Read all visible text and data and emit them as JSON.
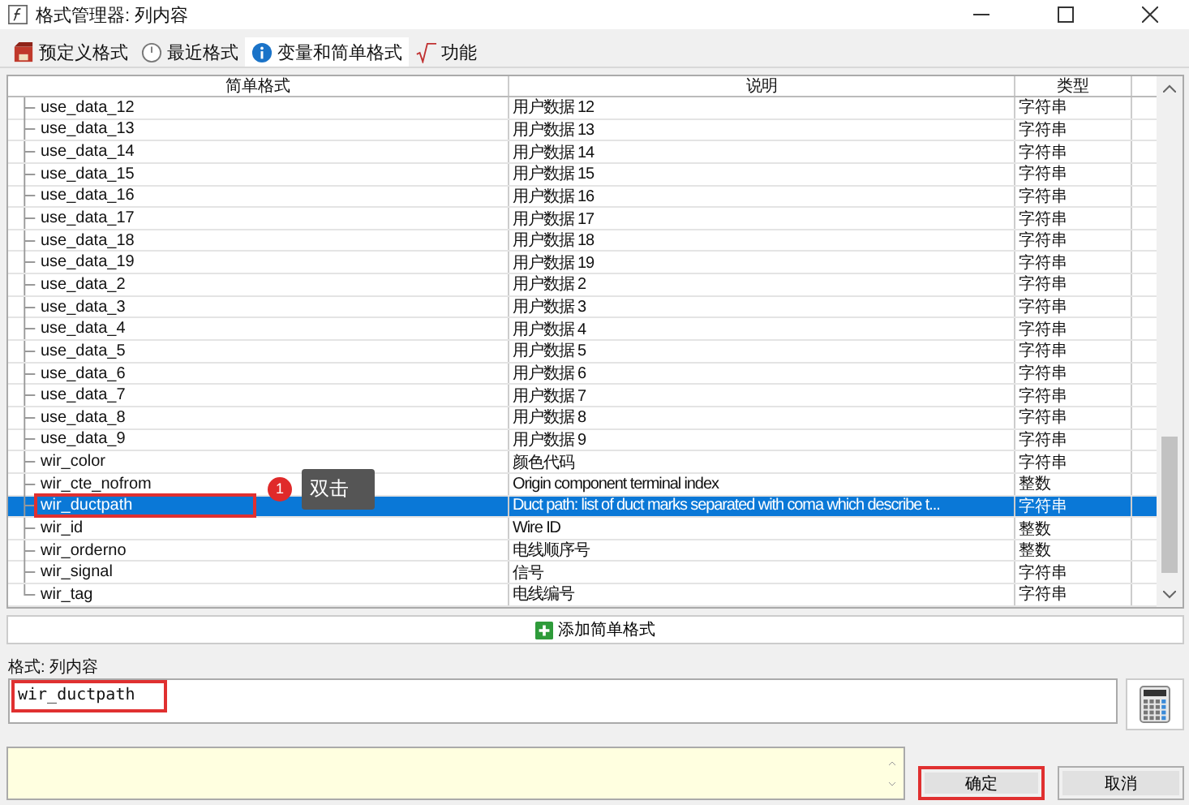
{
  "window": {
    "title": "格式管理器: 列内容"
  },
  "tabs": [
    {
      "label": "预定义格式",
      "selected": false
    },
    {
      "label": "最近格式",
      "selected": false
    },
    {
      "label": "变量和简单格式",
      "selected": true
    },
    {
      "label": "功能",
      "selected": false
    }
  ],
  "table": {
    "columns": [
      "简单格式",
      "说明",
      "类型"
    ],
    "rows": [
      {
        "name": "use_data_12",
        "desc": "用户数据 12",
        "type": "字符串",
        "selected": false
      },
      {
        "name": "use_data_13",
        "desc": "用户数据 13",
        "type": "字符串",
        "selected": false
      },
      {
        "name": "use_data_14",
        "desc": "用户数据 14",
        "type": "字符串",
        "selected": false
      },
      {
        "name": "use_data_15",
        "desc": "用户数据 15",
        "type": "字符串",
        "selected": false
      },
      {
        "name": "use_data_16",
        "desc": "用户数据 16",
        "type": "字符串",
        "selected": false
      },
      {
        "name": "use_data_17",
        "desc": "用户数据 17",
        "type": "字符串",
        "selected": false
      },
      {
        "name": "use_data_18",
        "desc": "用户数据 18",
        "type": "字符串",
        "selected": false
      },
      {
        "name": "use_data_19",
        "desc": "用户数据 19",
        "type": "字符串",
        "selected": false
      },
      {
        "name": "use_data_2",
        "desc": "用户数据 2",
        "type": "字符串",
        "selected": false
      },
      {
        "name": "use_data_3",
        "desc": "用户数据 3",
        "type": "字符串",
        "selected": false
      },
      {
        "name": "use_data_4",
        "desc": "用户数据 4",
        "type": "字符串",
        "selected": false
      },
      {
        "name": "use_data_5",
        "desc": "用户数据 5",
        "type": "字符串",
        "selected": false
      },
      {
        "name": "use_data_6",
        "desc": "用户数据 6",
        "type": "字符串",
        "selected": false
      },
      {
        "name": "use_data_7",
        "desc": "用户数据 7",
        "type": "字符串",
        "selected": false
      },
      {
        "name": "use_data_8",
        "desc": "用户数据 8",
        "type": "字符串",
        "selected": false
      },
      {
        "name": "use_data_9",
        "desc": "用户数据 9",
        "type": "字符串",
        "selected": false
      },
      {
        "name": "wir_color",
        "desc": "颜色代码",
        "type": "字符串",
        "selected": false
      },
      {
        "name": "wir_cte_nofrom",
        "desc": "Origin component terminal index",
        "type": "整数",
        "selected": false
      },
      {
        "name": "wir_ductpath",
        "desc": "Duct path: list of duct marks separated with coma which describe t...",
        "type": "字符串",
        "selected": true,
        "highlighted": true
      },
      {
        "name": "wir_id",
        "desc": "Wire ID",
        "type": "整数",
        "selected": false
      },
      {
        "name": "wir_orderno",
        "desc": "电线顺序号",
        "type": "整数",
        "selected": false
      },
      {
        "name": "wir_signal",
        "desc": "信号",
        "type": "字符串",
        "selected": false
      },
      {
        "name": "wir_tag",
        "desc": "电线编号",
        "type": "字符串",
        "selected": false
      }
    ]
  },
  "callout": {
    "badge": "1",
    "text": "双击"
  },
  "add_button": "添加简单格式",
  "format": {
    "label": "格式: 列内容",
    "value": "wir_ductpath",
    "highlighted": true
  },
  "buttons": [
    {
      "label": "确定",
      "highlighted": true
    },
    {
      "label": "取消",
      "highlighted": false
    }
  ]
}
